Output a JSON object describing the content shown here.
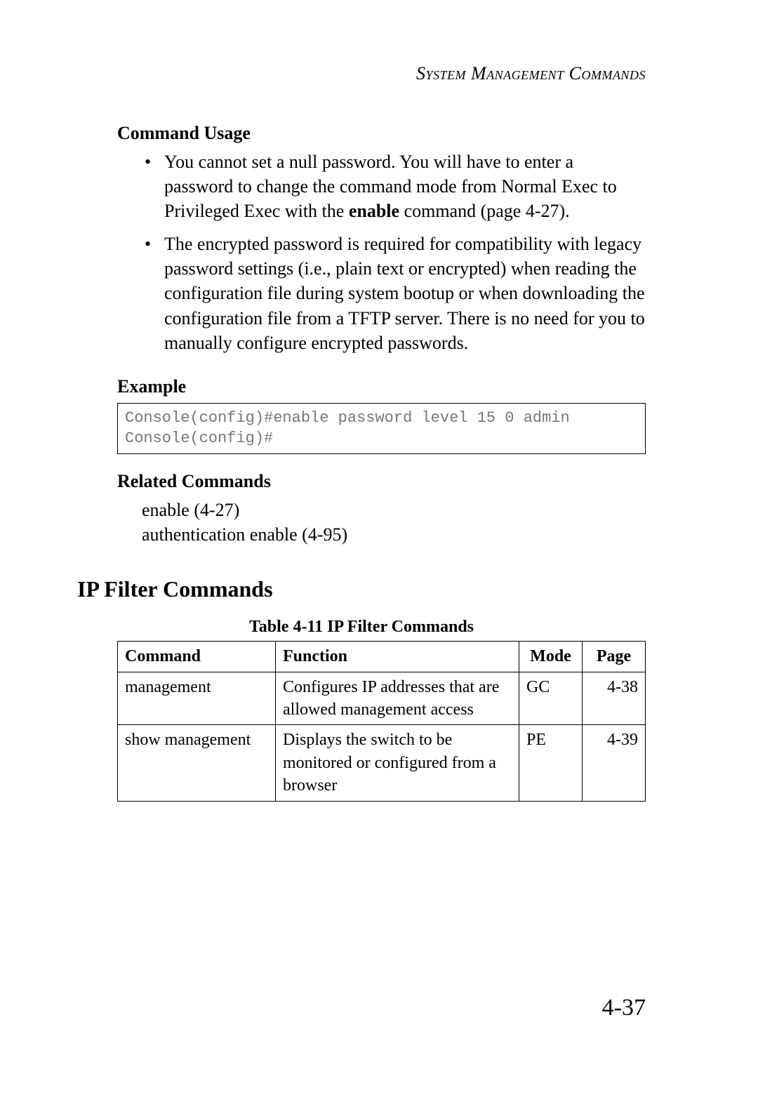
{
  "header": {
    "running": "System Management Commands"
  },
  "command_usage": {
    "heading": "Command Usage",
    "bullets": [
      {
        "pre": "You cannot set a null password. You will have to enter a password to change the command mode from Normal Exec to Privileged Exec with the ",
        "bold": "enable",
        "post": " command (page 4-27)."
      },
      {
        "text": "The encrypted password is required for compatibility with legacy password settings (i.e., plain text or encrypted) when reading the configuration file during system bootup or when downloading the configuration file from a TFTP server. There is no need for you to manually configure encrypted passwords."
      }
    ]
  },
  "example": {
    "heading": "Example",
    "code": "Console(config)#enable password level 15 0 admin\nConsole(config)#"
  },
  "related": {
    "heading": "Related Commands",
    "items": [
      "enable (4-27)",
      "authentication enable (4-95)"
    ]
  },
  "ip_filter": {
    "heading": "IP Filter Commands",
    "table_caption": "Table 4-11  IP Filter Commands",
    "columns": {
      "command": "Command",
      "function": "Function",
      "mode": "Mode",
      "page": "Page"
    },
    "rows": [
      {
        "command": "management",
        "function": "Configures IP addresses that are allowed management access",
        "mode": "GC",
        "page": "4-38"
      },
      {
        "command": "show management",
        "function": "Displays the switch to be monitored or configured from a browser",
        "mode": "PE",
        "page": "4-39"
      }
    ]
  },
  "page_number": "4-37"
}
